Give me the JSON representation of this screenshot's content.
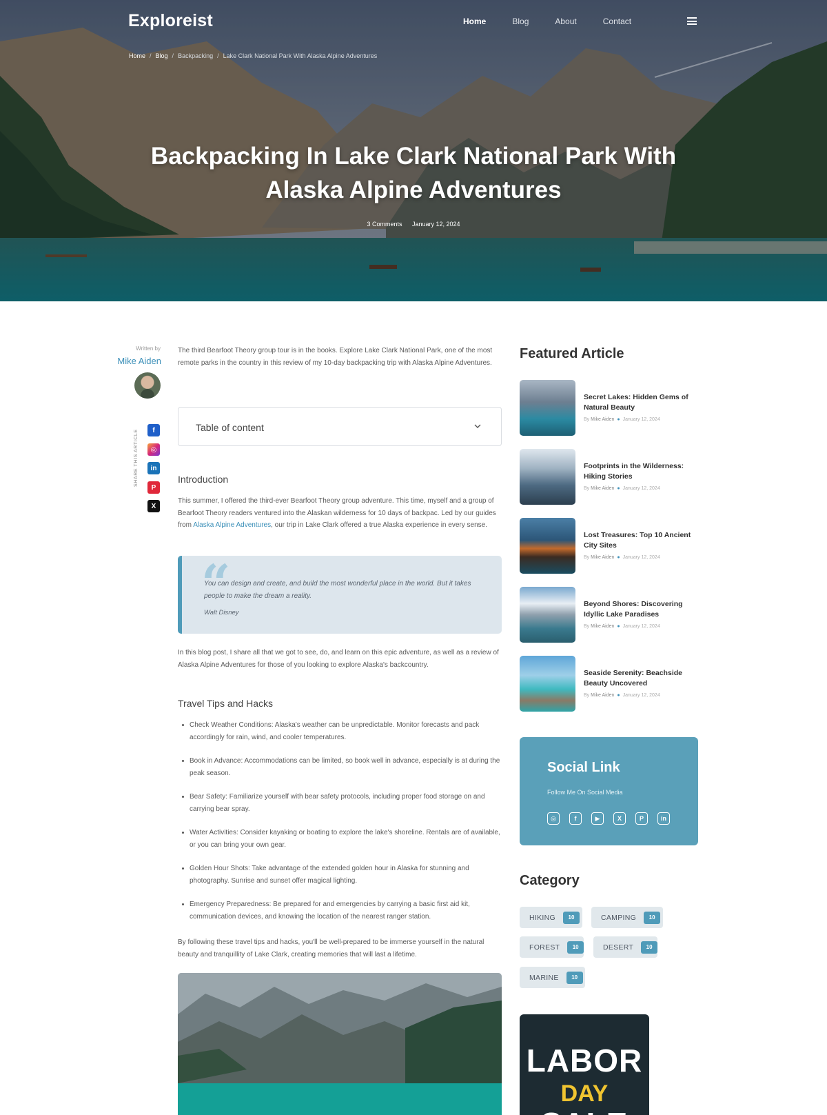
{
  "header": {
    "logo": "Exploreist",
    "nav": [
      "Home",
      "Blog",
      "About",
      "Contact"
    ],
    "active_nav": "Home"
  },
  "breadcrumb": {
    "items": [
      "Home",
      "Blog",
      "Backpacking",
      "Lake Clark National Park With Alaska Alpine Adventures"
    ]
  },
  "hero": {
    "title": "Backpacking In Lake Clark National Park With Alaska Alpine Adventures",
    "comments": "3 Comments",
    "date": "January 12, 2024"
  },
  "author": {
    "written_by": "Written by",
    "name": "Mike Aiden",
    "share_label": "SHARE THIS ARTICLE",
    "share_icons": [
      "facebook-icon",
      "instagram-icon",
      "linkedin-icon",
      "pinterest-icon",
      "x-icon"
    ]
  },
  "article": {
    "intro": "The third Bearfoot Theory group tour is in the books. Explore Lake Clark National Park, one of the most remote parks in the country in this review of my 10-day backpacking trip with Alaska Alpine Adventures.",
    "toc_label": "Table of content",
    "introduction_heading": "Introduction",
    "introduction_before_link": "This summer, I offered the third-ever Bearfoot Theory group adventure. This time, myself and a group of Bearfoot Theory readers ventured into the Alaskan wilderness for 10 days of backpac. Led by our guides from ",
    "introduction_link": "Alaska Alpine Adventures",
    "introduction_after_link": ", our trip in Lake Clark offered a true Alaska experience in every sense.",
    "quote_text": "You can design and create, and build the most wonderful place in the world. But it takes people to make the dream a reality.",
    "quote_author": "Walt Disney",
    "blog_post_paragraph": "In this blog post, I share all that we got to see, do, and learn on this epic adventure, as well as a review of Alaska Alpine Adventures for those of you looking to explore Alaska's backcountry.",
    "tips_heading": "Travel Tips and Hacks",
    "tips": [
      "Check Weather Conditions: Alaska's weather can be unpredictable. Monitor forecasts and pack accordingly for rain, wind, and cooler temperatures.",
      "Book in Advance: Accommodations can be limited, so book well in advance, especially is at during the peak season.",
      "Bear Safety: Familiarize yourself with bear safety protocols, including proper food storage on and carrying bear spray.",
      "Water Activities: Consider kayaking or boating to explore the lake's shoreline. Rentals are of available, or you can bring your own gear.",
      "Golden Hour Shots: Take advantage of the extended golden hour in Alaska for stunning and photography. Sunrise and sunset offer magical lighting.",
      "Emergency Preparedness: Be prepared for and emergencies by carrying a basic first aid kit, communication devices, and knowing the location of the nearest ranger station."
    ],
    "closing": "By following these travel tips and hacks, you'll be well-prepared to be immerse yourself in the natural beauty and tranquillity of Lake Clark, creating memories that will last a lifetime."
  },
  "sidebar": {
    "featured_title": "Featured Article",
    "featured": [
      {
        "title": "Secret Lakes: Hidden Gems of Natural Beauty",
        "by": "By",
        "author": "Mike Aiden",
        "date": "January 12, 2024"
      },
      {
        "title": "Footprints in the Wilderness: Hiking Stories",
        "by": "By",
        "author": "Mike Aiden",
        "date": "January 12, 2024"
      },
      {
        "title": "Lost Treasures: Top 10 Ancient City Sites",
        "by": "By",
        "author": "Mike Aiden",
        "date": "January 12, 2024"
      },
      {
        "title": "Beyond Shores: Discovering Idyllic Lake Paradises",
        "by": "By",
        "author": "Mike Aiden",
        "date": "January 12, 2024"
      },
      {
        "title": "Seaside Serenity: Beachside Beauty Uncovered",
        "by": "By",
        "author": "Mike Aiden",
        "date": "January 12, 2024"
      }
    ],
    "social_title": "Social Link",
    "social_subtitle": "Follow Me On Social Media",
    "social_icons": [
      "instagram-icon",
      "facebook-icon",
      "youtube-icon",
      "x-icon",
      "pinterest-icon",
      "linkedin-icon"
    ],
    "category_title": "Category",
    "categories": [
      {
        "label": "HIKING",
        "count": "10"
      },
      {
        "label": "CAMPING",
        "count": "10"
      },
      {
        "label": "FOREST",
        "count": "10"
      },
      {
        "label": "DESERT",
        "count": "10"
      },
      {
        "label": "MARINE",
        "count": "10"
      }
    ],
    "promo": {
      "line1": "LABOR",
      "line2": "DAY",
      "line3": "SALE"
    }
  },
  "colors": {
    "accent": "#4f9bb9",
    "link": "#3b8fb8",
    "social_box": "#5aa0b9",
    "chip_bg": "#e1e8ec",
    "quote_bg": "#dde6ed",
    "promo_bg": "#1d2b32",
    "promo_yellow": "#f0c430"
  }
}
